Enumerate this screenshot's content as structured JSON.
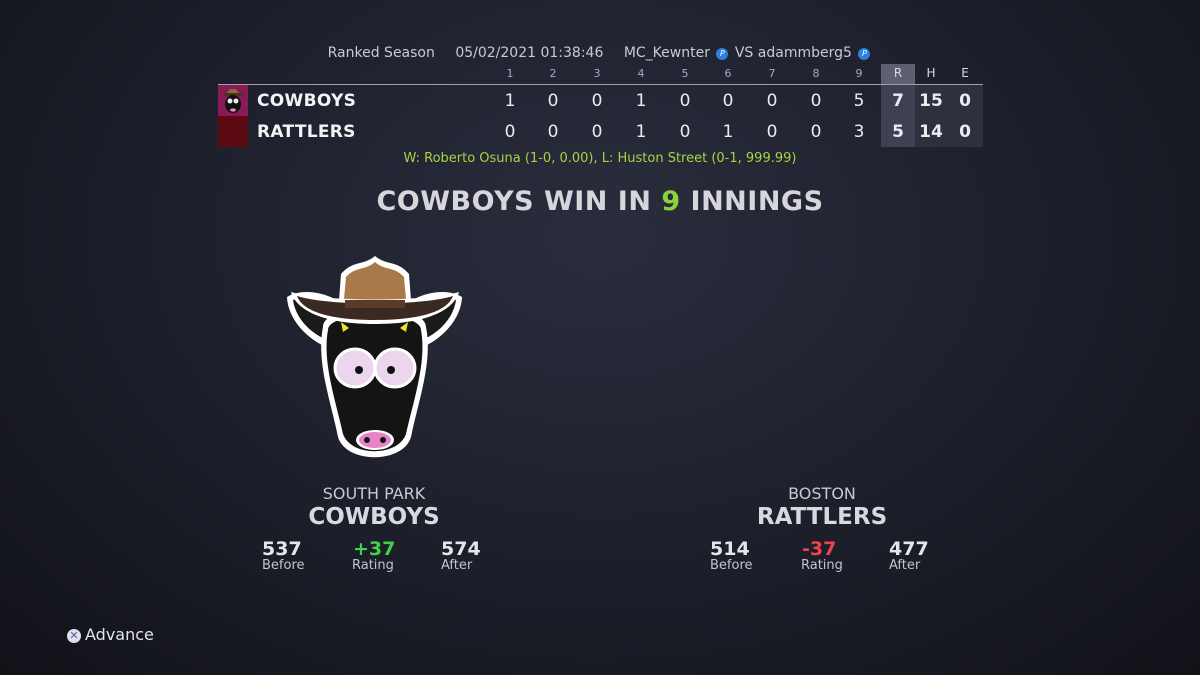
{
  "header": {
    "mode": "Ranked Season",
    "datetime": "05/02/2021 01:38:46",
    "player1": "MC_Kewnter",
    "vs": "VS",
    "player2": "adammberg5"
  },
  "linescore": {
    "innings": [
      "1",
      "2",
      "3",
      "4",
      "5",
      "6",
      "7",
      "8",
      "9"
    ],
    "totals_headers": [
      "R",
      "H",
      "E"
    ],
    "teams": [
      {
        "name": "COWBOYS",
        "scores": [
          "1",
          "0",
          "0",
          "1",
          "0",
          "0",
          "0",
          "0",
          "5"
        ],
        "R": "7",
        "H": "15",
        "E": "0",
        "color": "#8a1a55"
      },
      {
        "name": "RATTLERS",
        "scores": [
          "0",
          "0",
          "0",
          "1",
          "0",
          "1",
          "0",
          "0",
          "3"
        ],
        "R": "5",
        "H": "14",
        "E": "0",
        "color": "#5a0a10"
      }
    ]
  },
  "decision": "W: Roberto Osuna (1-0, 0.00), L: Huston Street (0-1, 999.99)",
  "result": {
    "prefix": "COWBOYS WIN IN ",
    "innings": "9",
    "suffix": " INNINGS"
  },
  "home": {
    "city": "SOUTH PARK",
    "team": "COWBOYS",
    "before": "537",
    "rating": "+37",
    "after": "574",
    "before_label": "Before",
    "rating_label": "Rating",
    "after_label": "After"
  },
  "away": {
    "city": "BOSTON",
    "team": "RATTLERS",
    "before": "514",
    "rating": "-37",
    "after": "477",
    "before_label": "Before",
    "rating_label": "Rating",
    "after_label": "After"
  },
  "footer": {
    "advance_label": "Advance",
    "button_icon": "cross-button-icon"
  },
  "colors": {
    "accent_green": "#8fd13b",
    "positive": "#3fd14a",
    "negative": "#f0444c",
    "ps_blue": "#2d7fe0"
  }
}
